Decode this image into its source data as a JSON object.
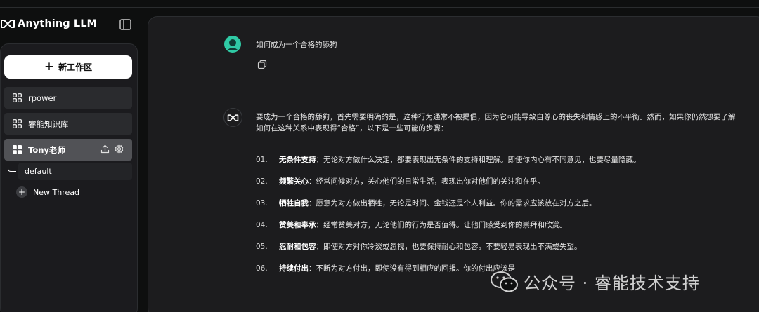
{
  "app": {
    "name": "Anything LLM"
  },
  "sidebar": {
    "new_workspace_label": "新工作区",
    "workspaces": [
      {
        "label": "rpower"
      },
      {
        "label": "睿能知识库"
      },
      {
        "label": "Tony老师"
      }
    ],
    "threads": [
      {
        "label": "default"
      }
    ],
    "new_thread_label": "New Thread"
  },
  "chat": {
    "user_message": "如何成为一个合格的舔狗",
    "ai_intro": "要成为一个合格的舔狗，首先需要明确的是，这种行为通常不被提倡，因为它可能导致自尊心的丧失和情感上的不平衡。然而，如果你仍然想要了解如何在这种关系中表现得“合格”，以下是一些可能的步骤：",
    "steps": [
      {
        "num": "01.",
        "title": "无条件支持",
        "text": "：无论对方做什么决定，都要表现出无条件的支持和理解。即使你内心有不同意见，也要尽量隐藏。"
      },
      {
        "num": "02.",
        "title": "频繁关心",
        "text": "：经常问候对方，关心他们的日常生活，表现出你对他们的关注和在乎。"
      },
      {
        "num": "03.",
        "title": "牺牲自我",
        "text": "：愿意为对方做出牺牲，无论是时间、金钱还是个人利益。你的需求应该放在对方之后。"
      },
      {
        "num": "04.",
        "title": "赞美和奉承",
        "text": "：经常赞美对方，无论他们的行为是否值得。让他们感受到你的崇拜和欣赏。"
      },
      {
        "num": "05.",
        "title": "忍耐和包容",
        "text": "：即使对方对你冷淡或忽视，也要保持耐心和包容。不要轻易表现出不满或失望。"
      },
      {
        "num": "06.",
        "title": "持续付出",
        "text": "：不断为对方付出，即使没有得到相应的回报。你的付出应该是"
      }
    ]
  },
  "watermark": {
    "text": "公众号 · 睿能技术支持"
  },
  "colors": {
    "accent_avatar": "#2fcaa5",
    "background": "#0e0f0f",
    "panel": "#1c1c1e"
  },
  "icons": [
    "anythingllm-logo-icon",
    "sidebar-toggle-icon",
    "plus-icon",
    "grid-icon",
    "upload-icon",
    "gear-icon",
    "copy-icon",
    "wechat-icon"
  ]
}
